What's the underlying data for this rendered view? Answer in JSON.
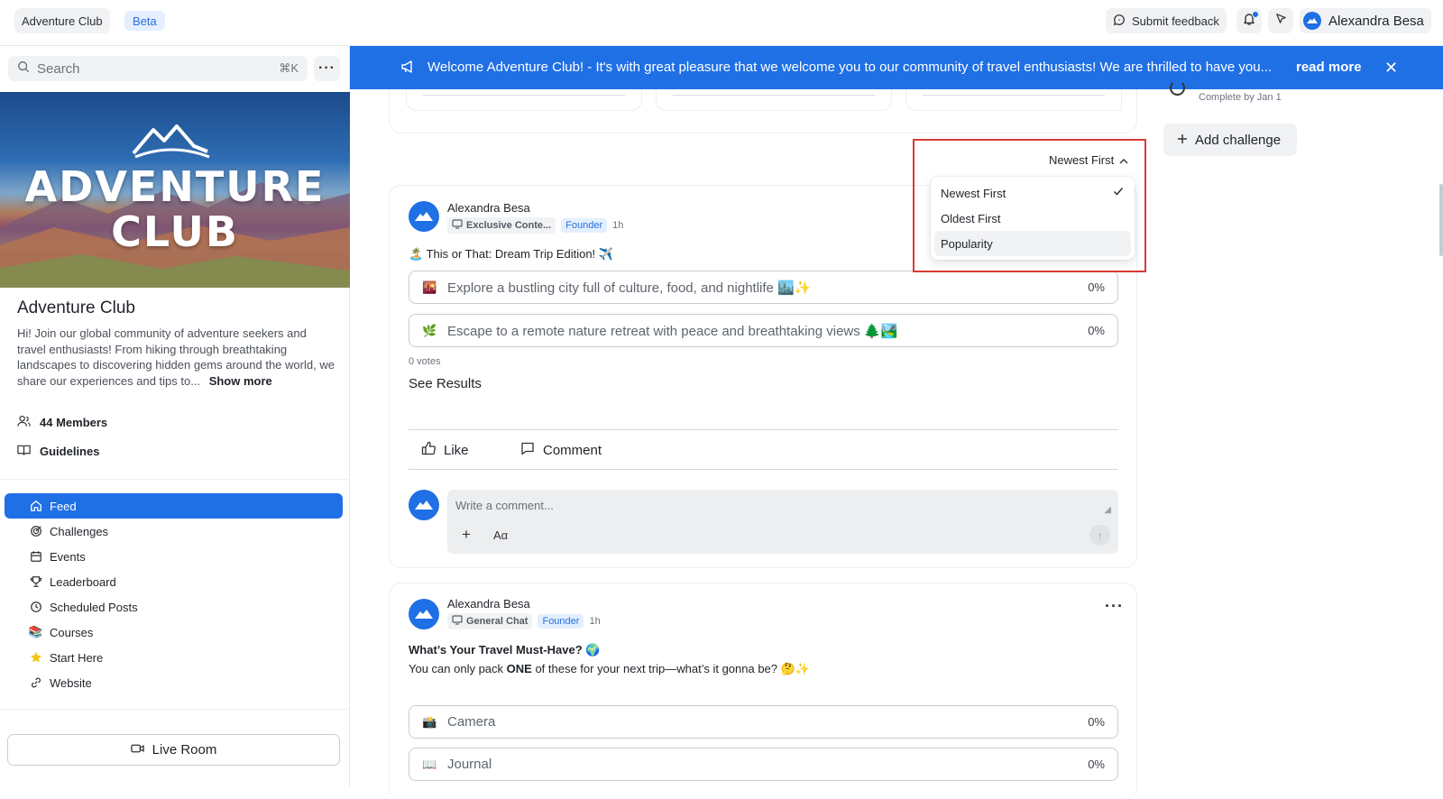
{
  "topbar": {
    "app_name": "Adventure Club",
    "beta_label": "Beta",
    "feedback_label": "Submit feedback",
    "user_name": "Alexandra Besa"
  },
  "sidebar": {
    "search_placeholder": "Search",
    "search_shortcut": "⌘K",
    "cover_title_line1": "ADVENTURE",
    "cover_title_line2": "CLUB",
    "club_name": "Adventure Club",
    "club_description": "Hi! Join our global community of adventure seekers and travel enthusiasts! From hiking through breathtaking landscapes to discovering hidden gems around the world, we share our experiences and tips to...",
    "show_more": "Show more",
    "members": "44 Members",
    "guidelines": "Guidelines",
    "nav": [
      {
        "label": "Feed",
        "icon": "home-icon",
        "active": true
      },
      {
        "label": "Challenges",
        "icon": "target-icon"
      },
      {
        "label": "Events",
        "icon": "calendar-icon"
      },
      {
        "label": "Leaderboard",
        "icon": "trophy-icon"
      },
      {
        "label": "Scheduled Posts",
        "icon": "clock-icon"
      },
      {
        "label": "Courses",
        "icon": "books-icon"
      },
      {
        "label": "Start Here",
        "icon": "star-icon"
      },
      {
        "label": "Website",
        "icon": "link-icon"
      }
    ],
    "live_room": "Live Room"
  },
  "banner": {
    "message": "Welcome Adventure Club! - It's with great pleasure that we welcome you to our community of travel enthusiasts! We are thrilled to have you...",
    "read_more": "read more"
  },
  "sort": {
    "current": "Newest First",
    "options": [
      "Newest First",
      "Oldest First",
      "Popularity"
    ],
    "selected_index": 0
  },
  "right_panel": {
    "complete_by": "Complete by Jan 1",
    "add_challenge": "Add challenge"
  },
  "posts": [
    {
      "author": "Alexandra Besa",
      "channel": "Exclusive Conte...",
      "role": "Founder",
      "time": "1h",
      "title": "🏝️ This or That: Dream Trip Edition! ✈️",
      "options": [
        {
          "emoji": "🌇",
          "text": "Explore a bustling city full of culture, food, and nightlife 🏙️✨",
          "percent": "0%"
        },
        {
          "emoji": "🌿",
          "text": "Escape to a remote nature retreat with peace and breathtaking views 🌲🏞️",
          "percent": "0%"
        }
      ],
      "votes": "0 votes",
      "see_results": "See Results",
      "like_label": "Like",
      "comment_label": "Comment",
      "comment_placeholder": "Write a comment...",
      "format_label": "Aα"
    },
    {
      "author": "Alexandra Besa",
      "channel": "General Chat",
      "role": "Founder",
      "time": "1h",
      "title": "What’s Your Travel Must-Have? 🌍",
      "body_prefix": "You can only pack ",
      "body_bold": "ONE",
      "body_suffix": " of these for your next trip—what’s it gonna be? 🤔✨",
      "options": [
        {
          "emoji": "📸",
          "text": "Camera",
          "percent": "0%"
        },
        {
          "emoji": "📖",
          "text": "Journal",
          "percent": "0%"
        }
      ]
    }
  ],
  "colors": {
    "accent": "#1f6fe5",
    "highlight_border": "#d93a36"
  }
}
